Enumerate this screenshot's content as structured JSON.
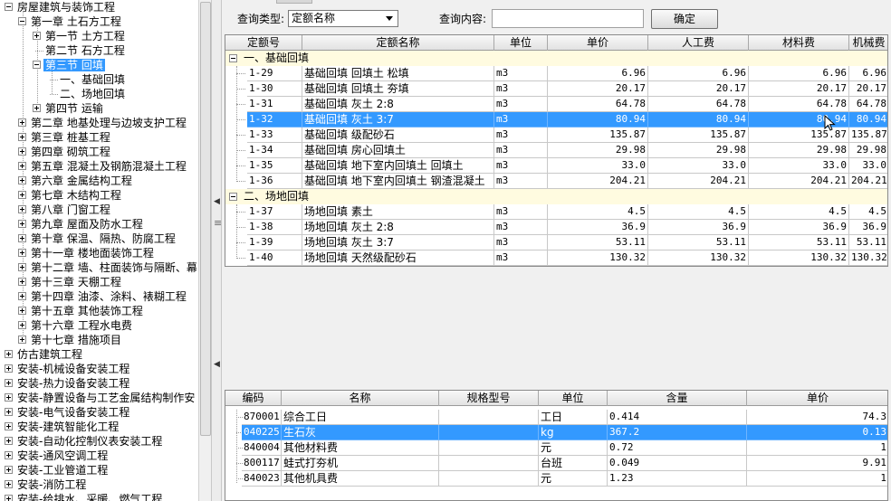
{
  "tree": {
    "items": [
      {
        "label": "房屋建筑与装饰工程",
        "level": 0,
        "toggle": "minus",
        "selected": false
      },
      {
        "label": "第一章 土石方工程",
        "level": 1,
        "toggle": "minus",
        "selected": false
      },
      {
        "label": "第一节 土方工程",
        "level": 2,
        "toggle": "plus",
        "selected": false
      },
      {
        "label": "第二节 石方工程",
        "level": 2,
        "toggle": "none",
        "selected": false
      },
      {
        "label": "第三节 回填",
        "level": 2,
        "toggle": "minus",
        "selected": true
      },
      {
        "label": "一、基础回填",
        "level": 3,
        "toggle": "none",
        "selected": false
      },
      {
        "label": "二、场地回填",
        "level": 3,
        "toggle": "none",
        "selected": false
      },
      {
        "label": "第四节 运输",
        "level": 2,
        "toggle": "plus",
        "selected": false
      },
      {
        "label": "第二章 地基处理与边坡支护工程",
        "level": 1,
        "toggle": "plus",
        "selected": false
      },
      {
        "label": "第三章 桩基工程",
        "level": 1,
        "toggle": "plus",
        "selected": false
      },
      {
        "label": "第四章 砌筑工程",
        "level": 1,
        "toggle": "plus",
        "selected": false
      },
      {
        "label": "第五章 混凝土及钢筋混凝土工程",
        "level": 1,
        "toggle": "plus",
        "selected": false
      },
      {
        "label": "第六章 金属结构工程",
        "level": 1,
        "toggle": "plus",
        "selected": false
      },
      {
        "label": "第七章 木结构工程",
        "level": 1,
        "toggle": "plus",
        "selected": false
      },
      {
        "label": "第八章 门窗工程",
        "level": 1,
        "toggle": "plus",
        "selected": false
      },
      {
        "label": "第九章 屋面及防水工程",
        "level": 1,
        "toggle": "plus",
        "selected": false
      },
      {
        "label": "第十章 保温、隔热、防腐工程",
        "level": 1,
        "toggle": "plus",
        "selected": false
      },
      {
        "label": "第十一章 楼地面装饰工程",
        "level": 1,
        "toggle": "plus",
        "selected": false
      },
      {
        "label": "第十二章 墙、柱面装饰与隔断、幕",
        "level": 1,
        "toggle": "plus",
        "selected": false
      },
      {
        "label": "第十三章 天棚工程",
        "level": 1,
        "toggle": "plus",
        "selected": false
      },
      {
        "label": "第十四章 油漆、涂料、裱糊工程",
        "level": 1,
        "toggle": "plus",
        "selected": false
      },
      {
        "label": "第十五章 其他装饰工程",
        "level": 1,
        "toggle": "plus",
        "selected": false
      },
      {
        "label": "第十六章 工程水电费",
        "level": 1,
        "toggle": "plus",
        "selected": false
      },
      {
        "label": "第十七章 措施项目",
        "level": 1,
        "toggle": "plus",
        "selected": false
      },
      {
        "label": "仿古建筑工程",
        "level": 0,
        "toggle": "plus",
        "selected": false
      },
      {
        "label": "安装-机械设备安装工程",
        "level": 0,
        "toggle": "plus",
        "selected": false
      },
      {
        "label": "安装-热力设备安装工程",
        "level": 0,
        "toggle": "plus",
        "selected": false
      },
      {
        "label": "安装-静置设备与工艺金属结构制作安",
        "level": 0,
        "toggle": "plus",
        "selected": false
      },
      {
        "label": "安装-电气设备安装工程",
        "level": 0,
        "toggle": "plus",
        "selected": false
      },
      {
        "label": "安装-建筑智能化工程",
        "level": 0,
        "toggle": "plus",
        "selected": false
      },
      {
        "label": "安装-自动化控制仪表安装工程",
        "level": 0,
        "toggle": "plus",
        "selected": false
      },
      {
        "label": "安装-通风空调工程",
        "level": 0,
        "toggle": "plus",
        "selected": false
      },
      {
        "label": "安装-工业管道工程",
        "level": 0,
        "toggle": "plus",
        "selected": false
      },
      {
        "label": "安装-消防工程",
        "level": 0,
        "toggle": "plus",
        "selected": false
      },
      {
        "label": "安装-给排水、采暖、燃气工程",
        "level": 0,
        "toggle": "plus",
        "selected": false
      }
    ]
  },
  "query": {
    "type_label": "查询类型:",
    "type_value": "定额名称",
    "content_label": "查询内容:",
    "content_value": "",
    "confirm_label": "确定"
  },
  "quota_table": {
    "columns": [
      "定额号",
      "定额名称",
      "单位",
      "单价",
      "人工费",
      "材料费",
      "机械费"
    ],
    "groups": [
      {
        "label": "一、基础回填",
        "rows": [
          {
            "code": "1-29",
            "name": "基础回填 回填土 松填",
            "unit": "m3",
            "price": "6.96",
            "labor": "6.96",
            "material": "6.96",
            "machine": "6.96",
            "selected": false
          },
          {
            "code": "1-30",
            "name": "基础回填 回填土 夯填",
            "unit": "m3",
            "price": "20.17",
            "labor": "20.17",
            "material": "20.17",
            "machine": "20.17",
            "selected": false
          },
          {
            "code": "1-31",
            "name": "基础回填 灰土 2:8",
            "unit": "m3",
            "price": "64.78",
            "labor": "64.78",
            "material": "64.78",
            "machine": "64.78",
            "selected": false
          },
          {
            "code": "1-32",
            "name": "基础回填 灰土 3:7",
            "unit": "m3",
            "price": "80.94",
            "labor": "80.94",
            "material": "80.94",
            "machine": "80.94",
            "selected": true
          },
          {
            "code": "1-33",
            "name": "基础回填 级配砂石",
            "unit": "m3",
            "price": "135.87",
            "labor": "135.87",
            "material": "135.87",
            "machine": "135.87",
            "selected": false
          },
          {
            "code": "1-34",
            "name": "基础回填 房心回填土",
            "unit": "m3",
            "price": "29.98",
            "labor": "29.98",
            "material": "29.98",
            "machine": "29.98",
            "selected": false
          },
          {
            "code": "1-35",
            "name": "基础回填 地下室内回填土 回填土",
            "unit": "m3",
            "price": "33.0",
            "labor": "33.0",
            "material": "33.0",
            "machine": "33.0",
            "selected": false
          },
          {
            "code": "1-36",
            "name": "基础回填 地下室内回填土 钢渣混凝土",
            "unit": "m3",
            "price": "204.21",
            "labor": "204.21",
            "material": "204.21",
            "machine": "204.21",
            "selected": false
          }
        ]
      },
      {
        "label": "二、场地回填",
        "rows": [
          {
            "code": "1-37",
            "name": "场地回填 素土",
            "unit": "m3",
            "price": "4.5",
            "labor": "4.5",
            "material": "4.5",
            "machine": "4.5",
            "selected": false
          },
          {
            "code": "1-38",
            "name": "场地回填 灰土 2:8",
            "unit": "m3",
            "price": "36.9",
            "labor": "36.9",
            "material": "36.9",
            "machine": "36.9",
            "selected": false
          },
          {
            "code": "1-39",
            "name": "场地回填 灰土 3:7",
            "unit": "m3",
            "price": "53.11",
            "labor": "53.11",
            "material": "53.11",
            "machine": "53.11",
            "selected": false
          },
          {
            "code": "1-40",
            "name": "场地回填 天然级配砂石",
            "unit": "m3",
            "price": "130.32",
            "labor": "130.32",
            "material": "130.32",
            "machine": "130.32",
            "selected": false
          }
        ]
      }
    ]
  },
  "resource_table": {
    "columns": [
      "编码",
      "名称",
      "规格型号",
      "单位",
      "含量",
      "单价"
    ],
    "rows": [
      {
        "code": "870001",
        "name": "综合工日",
        "spec": "",
        "unit": "工日",
        "amount": "0.414",
        "price": "74.3",
        "selected": false
      },
      {
        "code": "040225",
        "name": "生石灰",
        "spec": "",
        "unit": "kg",
        "amount": "367.2",
        "price": "0.13",
        "selected": true
      },
      {
        "code": "840004",
        "name": "其他材料费",
        "spec": "",
        "unit": "元",
        "amount": "0.72",
        "price": "1",
        "selected": false
      },
      {
        "code": "800117",
        "name": "蛙式打夯机",
        "spec": "",
        "unit": "台班",
        "amount": "0.049",
        "price": "9.91",
        "selected": false
      },
      {
        "code": "840023",
        "name": "其他机具费",
        "spec": "",
        "unit": "元",
        "amount": "1.23",
        "price": "1",
        "selected": false
      }
    ]
  },
  "colors": {
    "selection": "#3399ff",
    "group_row": "#fffbe0",
    "panel_bg": "#f0f0f0"
  }
}
